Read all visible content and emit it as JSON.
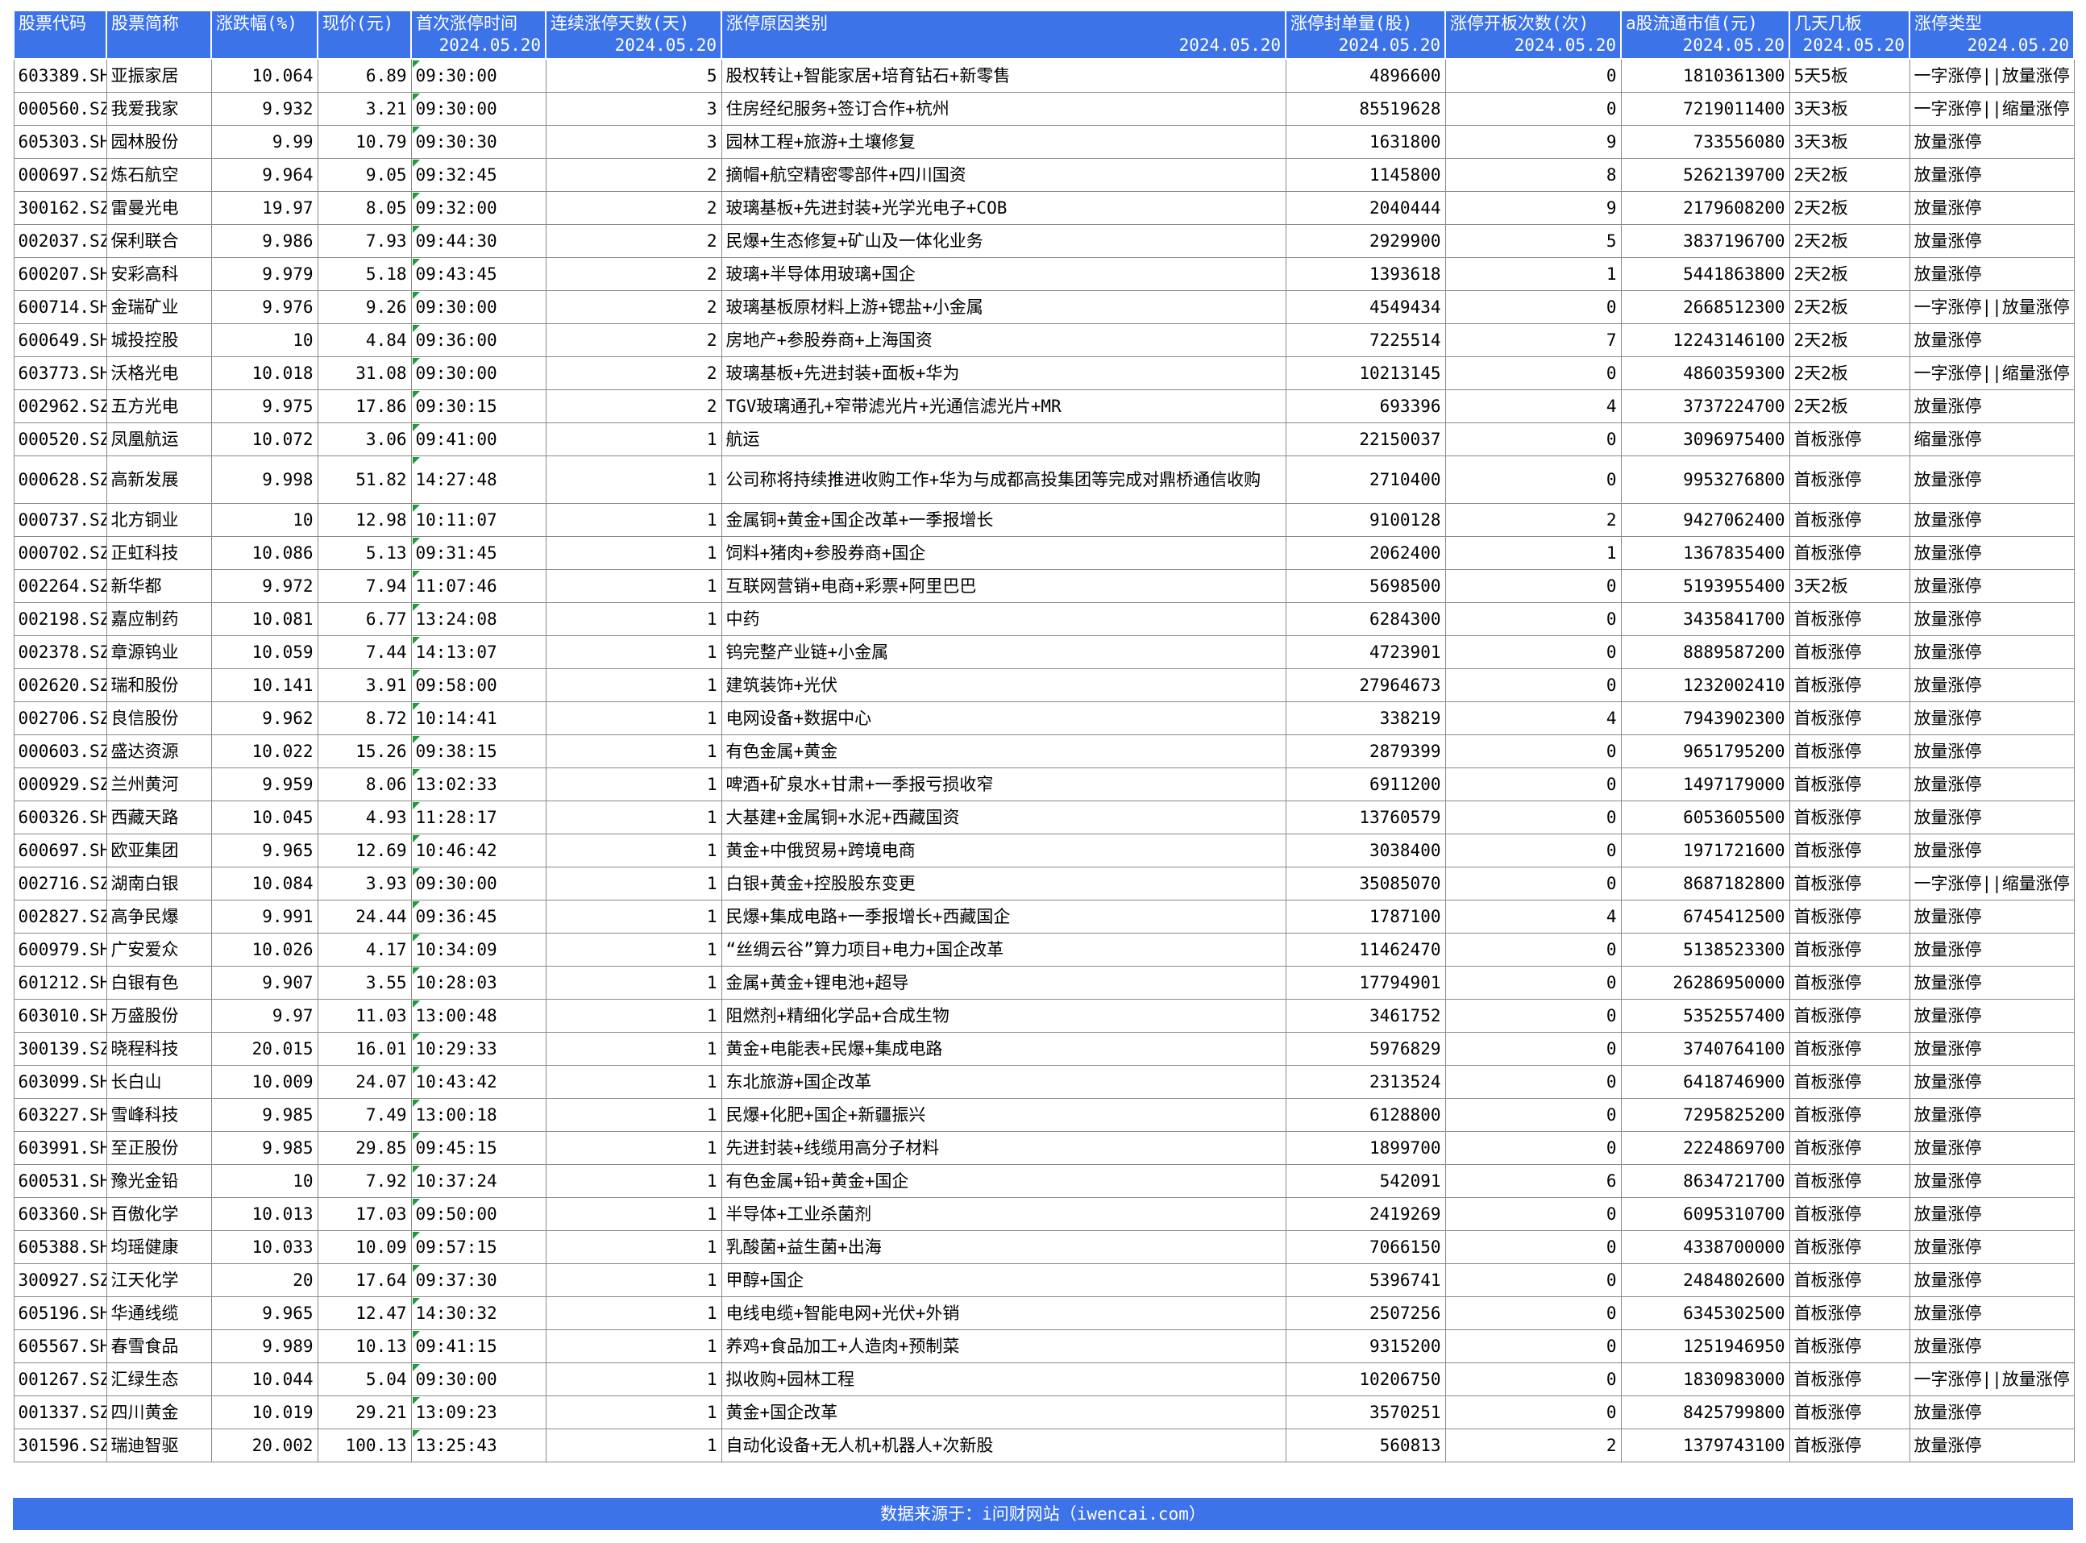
{
  "header": {
    "columns": [
      {
        "title": "股票代码",
        "sub": ""
      },
      {
        "title": "股票简称",
        "sub": ""
      },
      {
        "title": "涨跌幅(%)",
        "sub": ""
      },
      {
        "title": "现价(元)",
        "sub": ""
      },
      {
        "title": "首次涨停时间",
        "sub": "2024.05.20"
      },
      {
        "title": "连续涨停天数(天)",
        "sub": "2024.05.20"
      },
      {
        "title": "涨停原因类别",
        "sub": "2024.05.20"
      },
      {
        "title": "涨停封单量(股)",
        "sub": "2024.05.20"
      },
      {
        "title": "涨停开板次数(次)",
        "sub": "2024.05.20"
      },
      {
        "title": "a股流通市值(元)",
        "sub": "2024.05.20"
      },
      {
        "title": "几天几板",
        "sub": "2024.05.20"
      },
      {
        "title": "涨停类型",
        "sub": "2024.05.20"
      }
    ]
  },
  "rows": [
    [
      "603389.SH",
      "亚振家居",
      "10.064",
      "6.89",
      "09:30:00",
      "5",
      "股权转让+智能家居+培育钻石+新零售",
      "4896600",
      "0",
      "1810361300",
      "5天5板",
      "一字涨停||放量涨停"
    ],
    [
      "000560.SZ",
      "我爱我家",
      "9.932",
      "3.21",
      "09:30:00",
      "3",
      "住房经纪服务+签订合作+杭州",
      "85519628",
      "0",
      "7219011400",
      "3天3板",
      "一字涨停||缩量涨停"
    ],
    [
      "605303.SH",
      "园林股份",
      "9.99",
      "10.79",
      "09:30:30",
      "3",
      "园林工程+旅游+土壤修复",
      "1631800",
      "9",
      "733556080",
      "3天3板",
      "放量涨停"
    ],
    [
      "000697.SZ",
      "炼石航空",
      "9.964",
      "9.05",
      "09:32:45",
      "2",
      "摘帽+航空精密零部件+四川国资",
      "1145800",
      "8",
      "5262139700",
      "2天2板",
      "放量涨停"
    ],
    [
      "300162.SZ",
      "雷曼光电",
      "19.97",
      "8.05",
      "09:32:00",
      "2",
      "玻璃基板+先进封装+光学光电子+COB",
      "2040444",
      "9",
      "2179608200",
      "2天2板",
      "放量涨停"
    ],
    [
      "002037.SZ",
      "保利联合",
      "9.986",
      "7.93",
      "09:44:30",
      "2",
      "民爆+生态修复+矿山及一体化业务",
      "2929900",
      "5",
      "3837196700",
      "2天2板",
      "放量涨停"
    ],
    [
      "600207.SH",
      "安彩高科",
      "9.979",
      "5.18",
      "09:43:45",
      "2",
      "玻璃+半导体用玻璃+国企",
      "1393618",
      "1",
      "5441863800",
      "2天2板",
      "放量涨停"
    ],
    [
      "600714.SH",
      "金瑞矿业",
      "9.976",
      "9.26",
      "09:30:00",
      "2",
      "玻璃基板原材料上游+锶盐+小金属",
      "4549434",
      "0",
      "2668512300",
      "2天2板",
      "一字涨停||放量涨停"
    ],
    [
      "600649.SH",
      "城投控股",
      "10",
      "4.84",
      "09:36:00",
      "2",
      "房地产+参股券商+上海国资",
      "7225514",
      "7",
      "12243146100",
      "2天2板",
      "放量涨停"
    ],
    [
      "603773.SH",
      "沃格光电",
      "10.018",
      "31.08",
      "09:30:00",
      "2",
      "玻璃基板+先进封装+面板+华为",
      "10213145",
      "0",
      "4860359300",
      "2天2板",
      "一字涨停||缩量涨停"
    ],
    [
      "002962.SZ",
      "五方光电",
      "9.975",
      "17.86",
      "09:30:15",
      "2",
      "TGV玻璃通孔+窄带滤光片+光通信滤光片+MR",
      "693396",
      "4",
      "3737224700",
      "2天2板",
      "放量涨停"
    ],
    [
      "000520.SZ",
      "凤凰航运",
      "10.072",
      "3.06",
      "09:41:00",
      "1",
      "航运",
      "22150037",
      "0",
      "3096975400",
      "首板涨停",
      "缩量涨停"
    ],
    [
      "000628.SZ",
      "高新发展",
      "9.998",
      "51.82",
      "14:27:48",
      "1",
      "公司称将持续推进收购工作+华为与成都高投集团等完成对鼎桥通信收购",
      "2710400",
      "0",
      "9953276800",
      "首板涨停",
      "放量涨停"
    ],
    [
      "000737.SZ",
      "北方铜业",
      "10",
      "12.98",
      "10:11:07",
      "1",
      "金属铜+黄金+国企改革+一季报增长",
      "9100128",
      "2",
      "9427062400",
      "首板涨停",
      "放量涨停"
    ],
    [
      "000702.SZ",
      "正虹科技",
      "10.086",
      "5.13",
      "09:31:45",
      "1",
      "饲料+猪肉+参股券商+国企",
      "2062400",
      "1",
      "1367835400",
      "首板涨停",
      "放量涨停"
    ],
    [
      "002264.SZ",
      "新华都",
      "9.972",
      "7.94",
      "11:07:46",
      "1",
      "互联网营销+电商+彩票+阿里巴巴",
      "5698500",
      "0",
      "5193955400",
      "3天2板",
      "放量涨停"
    ],
    [
      "002198.SZ",
      "嘉应制药",
      "10.081",
      "6.77",
      "13:24:08",
      "1",
      "中药",
      "6284300",
      "0",
      "3435841700",
      "首板涨停",
      "放量涨停"
    ],
    [
      "002378.SZ",
      "章源钨业",
      "10.059",
      "7.44",
      "14:13:07",
      "1",
      "钨完整产业链+小金属",
      "4723901",
      "0",
      "8889587200",
      "首板涨停",
      "放量涨停"
    ],
    [
      "002620.SZ",
      "瑞和股份",
      "10.141",
      "3.91",
      "09:58:00",
      "1",
      "建筑装饰+光伏",
      "27964673",
      "0",
      "1232002410",
      "首板涨停",
      "放量涨停"
    ],
    [
      "002706.SZ",
      "良信股份",
      "9.962",
      "8.72",
      "10:14:41",
      "1",
      "电网设备+数据中心",
      "338219",
      "4",
      "7943902300",
      "首板涨停",
      "放量涨停"
    ],
    [
      "000603.SZ",
      "盛达资源",
      "10.022",
      "15.26",
      "09:38:15",
      "1",
      "有色金属+黄金",
      "2879399",
      "0",
      "9651795200",
      "首板涨停",
      "放量涨停"
    ],
    [
      "000929.SZ",
      "兰州黄河",
      "9.959",
      "8.06",
      "13:02:33",
      "1",
      "啤酒+矿泉水+甘肃+一季报亏损收窄",
      "6911200",
      "0",
      "1497179000",
      "首板涨停",
      "放量涨停"
    ],
    [
      "600326.SH",
      "西藏天路",
      "10.045",
      "4.93",
      "11:28:17",
      "1",
      "大基建+金属铜+水泥+西藏国资",
      "13760579",
      "0",
      "6053605500",
      "首板涨停",
      "放量涨停"
    ],
    [
      "600697.SH",
      "欧亚集团",
      "9.965",
      "12.69",
      "10:46:42",
      "1",
      "黄金+中俄贸易+跨境电商",
      "3038400",
      "0",
      "1971721600",
      "首板涨停",
      "放量涨停"
    ],
    [
      "002716.SZ",
      "湖南白银",
      "10.084",
      "3.93",
      "09:30:00",
      "1",
      "白银+黄金+控股股东变更",
      "35085070",
      "0",
      "8687182800",
      "首板涨停",
      "一字涨停||缩量涨停"
    ],
    [
      "002827.SZ",
      "高争民爆",
      "9.991",
      "24.44",
      "09:36:45",
      "1",
      "民爆+集成电路+一季报增长+西藏国企",
      "1787100",
      "4",
      "6745412500",
      "首板涨停",
      "放量涨停"
    ],
    [
      "600979.SH",
      "广安爱众",
      "10.026",
      "4.17",
      "10:34:09",
      "1",
      "“丝绸云谷”算力项目+电力+国企改革",
      "11462470",
      "0",
      "5138523300",
      "首板涨停",
      "放量涨停"
    ],
    [
      "601212.SH",
      "白银有色",
      "9.907",
      "3.55",
      "10:28:03",
      "1",
      "金属+黄金+锂电池+超导",
      "17794901",
      "0",
      "26286950000",
      "首板涨停",
      "放量涨停"
    ],
    [
      "603010.SH",
      "万盛股份",
      "9.97",
      "11.03",
      "13:00:48",
      "1",
      "阻燃剂+精细化学品+合成生物",
      "3461752",
      "0",
      "5352557400",
      "首板涨停",
      "放量涨停"
    ],
    [
      "300139.SZ",
      "晓程科技",
      "20.015",
      "16.01",
      "10:29:33",
      "1",
      "黄金+电能表+民爆+集成电路",
      "5976829",
      "0",
      "3740764100",
      "首板涨停",
      "放量涨停"
    ],
    [
      "603099.SH",
      "长白山",
      "10.009",
      "24.07",
      "10:43:42",
      "1",
      "东北旅游+国企改革",
      "2313524",
      "0",
      "6418746900",
      "首板涨停",
      "放量涨停"
    ],
    [
      "603227.SH",
      "雪峰科技",
      "9.985",
      "7.49",
      "13:00:18",
      "1",
      "民爆+化肥+国企+新疆振兴",
      "6128800",
      "0",
      "7295825200",
      "首板涨停",
      "放量涨停"
    ],
    [
      "603991.SH",
      "至正股份",
      "9.985",
      "29.85",
      "09:45:15",
      "1",
      "先进封装+线缆用高分子材料",
      "1899700",
      "0",
      "2224869700",
      "首板涨停",
      "放量涨停"
    ],
    [
      "600531.SH",
      "豫光金铅",
      "10",
      "7.92",
      "10:37:24",
      "1",
      "有色金属+铅+黄金+国企",
      "542091",
      "6",
      "8634721700",
      "首板涨停",
      "放量涨停"
    ],
    [
      "603360.SH",
      "百傲化学",
      "10.013",
      "17.03",
      "09:50:00",
      "1",
      "半导体+工业杀菌剂",
      "2419269",
      "0",
      "6095310700",
      "首板涨停",
      "放量涨停"
    ],
    [
      "605388.SH",
      "均瑶健康",
      "10.033",
      "10.09",
      "09:57:15",
      "1",
      "乳酸菌+益生菌+出海",
      "7066150",
      "0",
      "4338700000",
      "首板涨停",
      "放量涨停"
    ],
    [
      "300927.SZ",
      "江天化学",
      "20",
      "17.64",
      "09:37:30",
      "1",
      "甲醇+国企",
      "5396741",
      "0",
      "2484802600",
      "首板涨停",
      "放量涨停"
    ],
    [
      "605196.SH",
      "华通线缆",
      "9.965",
      "12.47",
      "14:30:32",
      "1",
      "电线电缆+智能电网+光伏+外销",
      "2507256",
      "0",
      "6345302500",
      "首板涨停",
      "放量涨停"
    ],
    [
      "605567.SH",
      "春雪食品",
      "9.989",
      "10.13",
      "09:41:15",
      "1",
      "养鸡+食品加工+人造肉+预制菜",
      "9315200",
      "0",
      "1251946950",
      "首板涨停",
      "放量涨停"
    ],
    [
      "001267.SZ",
      "汇绿生态",
      "10.044",
      "5.04",
      "09:30:00",
      "1",
      "拟收购+园林工程",
      "10206750",
      "0",
      "1830983000",
      "首板涨停",
      "一字涨停||放量涨停"
    ],
    [
      "001337.SZ",
      "四川黄金",
      "10.019",
      "29.21",
      "13:09:23",
      "1",
      "黄金+国企改革",
      "3570251",
      "0",
      "8425799800",
      "首板涨停",
      "放量涨停"
    ],
    [
      "301596.SZ",
      "瑞迪智驱",
      "20.002",
      "100.13",
      "13:25:43",
      "1",
      "自动化设备+无人机+机器人+次新股",
      "560813",
      "2",
      "1379743100",
      "首板涨停",
      "放量涨停"
    ]
  ],
  "footer": {
    "source": "数据来源于：i问财网站（iwencai.com）"
  },
  "colors": {
    "header_bg": "#3d73e8",
    "header_text": "#ffffff",
    "time_marker": "#1d9c3b"
  }
}
